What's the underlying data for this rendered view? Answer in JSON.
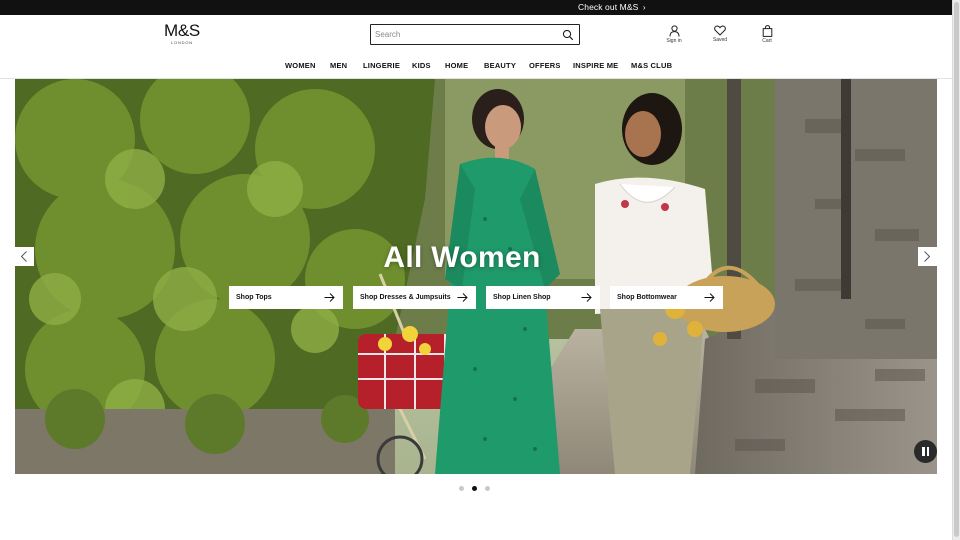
{
  "promo": {
    "text": "Check out M&S",
    "chevron": "›"
  },
  "logo": {
    "main": "M&S",
    "sub": "LONDON"
  },
  "search": {
    "placeholder": "Search",
    "value": "",
    "icon": "search-icon"
  },
  "header_icons": [
    {
      "name": "user-icon",
      "label": "Sign in"
    },
    {
      "name": "heart-icon",
      "label": "Saved"
    },
    {
      "name": "bag-icon",
      "label": "Cart"
    }
  ],
  "nav": {
    "items": [
      "WOMEN",
      "MEN",
      "LINGERIE",
      "KIDS",
      "HOME",
      "BEAUTY",
      "OFFERS",
      "INSPIRE ME",
      "M&S CLUB"
    ]
  },
  "hero": {
    "title": "All Women",
    "ctas": [
      {
        "label": "Shop Tops"
      },
      {
        "label": "Shop Dresses & Jumpsuits"
      },
      {
        "label": "Shop Linen Shop"
      },
      {
        "label": "Shop Bottomwear"
      }
    ],
    "prev_icon": "chevron-left-icon",
    "next_icon": "chevron-right-icon",
    "pause_icon": "pause-icon"
  },
  "carousel": {
    "slide_count": 3,
    "active_index": 1
  },
  "colors": {
    "promo_bg": "#111111",
    "accent": "#111111",
    "dress_green": "#1f9a6a",
    "foliage": "#5f7d2a"
  }
}
